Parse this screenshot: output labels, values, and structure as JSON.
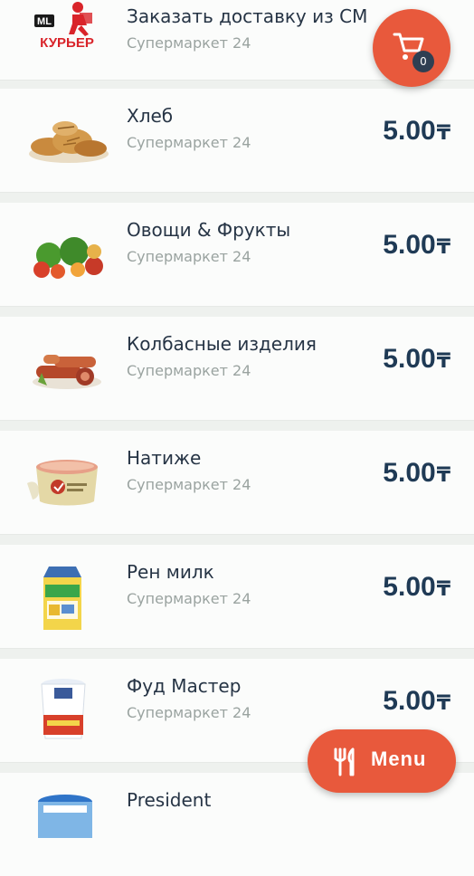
{
  "colors": {
    "accent": "#e8593c",
    "price": "#1f3a55",
    "title": "#263445",
    "subtitle": "#9aa3a0",
    "badge": "#2f3f52"
  },
  "courier_logo": {
    "top": "ML",
    "bottom": "КУРЬЕР"
  },
  "items": [
    {
      "title": "Заказать доставку из СМ",
      "subtitle": "Супермаркет 24",
      "price": "",
      "currency": "",
      "icon": "courier-logo"
    },
    {
      "title": "Хлеб",
      "subtitle": "Супермаркет 24",
      "price": "5.00",
      "currency": "₸",
      "icon": "bread-image"
    },
    {
      "title": "Овощи & Фрукты",
      "subtitle": "Супермаркет 24",
      "price": "5.00",
      "currency": "₸",
      "icon": "vegetables-image"
    },
    {
      "title": "Колбасные изделия",
      "subtitle": "Супермаркет 24",
      "price": "5.00",
      "currency": "₸",
      "icon": "sausages-image"
    },
    {
      "title": "Натиже",
      "subtitle": "Супермаркет 24",
      "price": "5.00",
      "currency": "₸",
      "icon": "container-image"
    },
    {
      "title": "Рен милк",
      "subtitle": "Супермаркет 24",
      "price": "5.00",
      "currency": "₸",
      "icon": "milk-carton-image"
    },
    {
      "title": "Фуд Мастер",
      "subtitle": "Супермаркет 24",
      "price": "5.00",
      "currency": "₸",
      "icon": "yogurt-cup-image"
    },
    {
      "title": "President",
      "subtitle": "",
      "price": "",
      "currency": "",
      "icon": "cheese-cup-image"
    }
  ],
  "cart": {
    "count": "0",
    "icon": "cart-icon"
  },
  "menu_button": {
    "label": "Menu",
    "icon": "fork-knife-icon"
  }
}
